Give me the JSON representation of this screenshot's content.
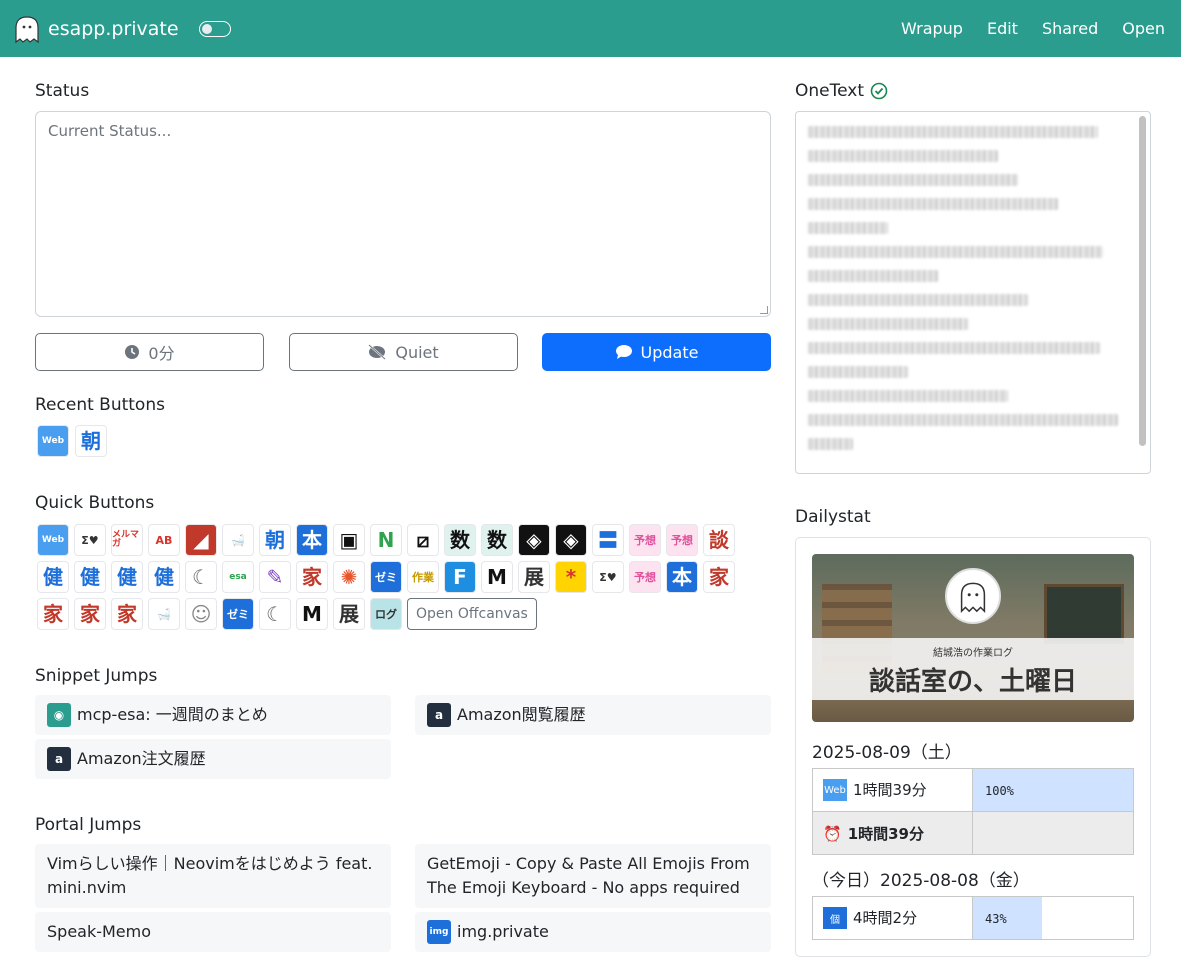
{
  "navbar": {
    "brand": "esapp.private",
    "links": [
      "Wrapup",
      "Edit",
      "Shared",
      "Open"
    ]
  },
  "status": {
    "title": "Status",
    "placeholder": "Current Status...",
    "timer_label": "0分",
    "quiet_label": "Quiet",
    "update_label": "Update"
  },
  "recent": {
    "title": "Recent Buttons",
    "items": [
      {
        "label": "Web",
        "bg": "#4a9ef0",
        "fg": "#ffffff"
      },
      {
        "label": "朝",
        "bg": "#ffffff",
        "fg": "#1e6fd9"
      }
    ]
  },
  "quick": {
    "title": "Quick Buttons",
    "items": [
      {
        "label": "Web",
        "bg": "#4a9ef0",
        "fg": "#ffffff"
      },
      {
        "label": "Σ♥",
        "bg": "#ffffff",
        "fg": "#333333"
      },
      {
        "label": "メルマガ",
        "bg": "#ffffff",
        "fg": "#d9342b"
      },
      {
        "label": "AB",
        "bg": "#ffffff",
        "fg": "#d9342b"
      },
      {
        "label": "◢",
        "bg": "#c0392b",
        "fg": "#ffffff"
      },
      {
        "label": "🛁",
        "bg": "#ffffff",
        "fg": "#888888"
      },
      {
        "label": "朝",
        "bg": "#ffffff",
        "fg": "#1e6fd9"
      },
      {
        "label": "本",
        "bg": "#1e6fd9",
        "fg": "#ffffff"
      },
      {
        "label": "▣",
        "bg": "#ffffff",
        "fg": "#111111"
      },
      {
        "label": "N",
        "bg": "#ffffff",
        "fg": "#2ea44f"
      },
      {
        "label": "⧄",
        "bg": "#ffffff",
        "fg": "#111111"
      },
      {
        "label": "数",
        "bg": "#e0f2ee",
        "fg": "#111111"
      },
      {
        "label": "数",
        "bg": "#e0f2ee",
        "fg": "#111111"
      },
      {
        "label": "◈",
        "bg": "#111111",
        "fg": "#ffffff"
      },
      {
        "label": "◈",
        "bg": "#111111",
        "fg": "#ffffff"
      },
      {
        "label": "〓",
        "bg": "#ffffff",
        "fg": "#1e6fd9"
      },
      {
        "label": "予想",
        "bg": "#fde2ef",
        "fg": "#e0529c"
      },
      {
        "label": "予想",
        "bg": "#fde2ef",
        "fg": "#e0529c"
      },
      {
        "label": "談",
        "bg": "#ffffff",
        "fg": "#c0392b"
      },
      {
        "label": "健",
        "bg": "#ffffff",
        "fg": "#1e6fd9"
      },
      {
        "label": "健",
        "bg": "#ffffff",
        "fg": "#1e6fd9"
      },
      {
        "label": "健",
        "bg": "#ffffff",
        "fg": "#1e6fd9"
      },
      {
        "label": "健",
        "bg": "#ffffff",
        "fg": "#1e6fd9"
      },
      {
        "label": "☾",
        "bg": "#ffffff",
        "fg": "#666666"
      },
      {
        "label": "esa",
        "bg": "#ffffff",
        "fg": "#2ea44f"
      },
      {
        "label": "✎",
        "bg": "#ffffff",
        "fg": "#7b3fc4"
      },
      {
        "label": "家",
        "bg": "#ffffff",
        "fg": "#c0392b"
      },
      {
        "label": "✺",
        "bg": "#ffffff",
        "fg": "#e8542c"
      },
      {
        "label": "ゼミ",
        "bg": "#1e6fd9",
        "fg": "#ffffff"
      },
      {
        "label": "作業",
        "bg": "#ffffff",
        "fg": "#c79a00"
      },
      {
        "label": "F",
        "bg": "#1e8fe0",
        "fg": "#ffffff"
      },
      {
        "label": "M",
        "bg": "#ffffff",
        "fg": "#111111"
      },
      {
        "label": "展",
        "bg": "#ffffff",
        "fg": "#333333"
      },
      {
        "label": "*",
        "bg": "#ffd400",
        "fg": "#d9342b"
      },
      {
        "label": "Σ♥",
        "bg": "#ffffff",
        "fg": "#333333"
      },
      {
        "label": "予想",
        "bg": "#fde2ef",
        "fg": "#e0529c"
      },
      {
        "label": "本",
        "bg": "#1e6fd9",
        "fg": "#ffffff"
      },
      {
        "label": "家",
        "bg": "#ffffff",
        "fg": "#c0392b"
      },
      {
        "label": "家",
        "bg": "#ffffff",
        "fg": "#c0392b"
      },
      {
        "label": "家",
        "bg": "#ffffff",
        "fg": "#c0392b"
      },
      {
        "label": "家",
        "bg": "#ffffff",
        "fg": "#c0392b"
      },
      {
        "label": "🛁",
        "bg": "#ffffff",
        "fg": "#888888"
      },
      {
        "label": "☺",
        "bg": "#ffffff",
        "fg": "#888888"
      },
      {
        "label": "ゼミ",
        "bg": "#1e6fd9",
        "fg": "#ffffff"
      },
      {
        "label": "☾",
        "bg": "#ffffff",
        "fg": "#666666"
      },
      {
        "label": "M",
        "bg": "#ffffff",
        "fg": "#111111"
      },
      {
        "label": "展",
        "bg": "#ffffff",
        "fg": "#333333"
      },
      {
        "label": "ログ",
        "bg": "#b8e4e8",
        "fg": "#333333"
      }
    ],
    "offcanvas_label": "Open Offcanvas"
  },
  "snippets": {
    "title": "Snippet Jumps",
    "items": [
      {
        "label": "mcp-esa: 一週間のまとめ",
        "icon_bg": "#2a9d8f",
        "icon_text": "e"
      },
      {
        "label": "Amazon閲覧履歴",
        "icon_bg": "#232f3e",
        "icon_text": "a"
      },
      {
        "label": "Amazon注文履歴",
        "icon_bg": "#232f3e",
        "icon_text": "a"
      }
    ]
  },
  "portal": {
    "title": "Portal Jumps",
    "items": [
      {
        "label": "Vimらしい操作｜Neovimをはじめよう feat. mini.nvim"
      },
      {
        "label": "GetEmoji - Copy & Paste All Emojis From The Emoji Keyboard - No apps required"
      },
      {
        "label": "Speak-Memo"
      },
      {
        "label": "img.private"
      }
    ]
  },
  "onetext": {
    "title": "OneText"
  },
  "dailystat": {
    "title": "Dailystat",
    "hero_sub": "結城浩の作業ログ",
    "hero_main": "談話室の、土曜日",
    "day1": {
      "date": "2025-08-09（土）",
      "rows": [
        {
          "label": "1時間39分",
          "percent_text": "100%",
          "percent": 100
        }
      ],
      "total": "1時間39分"
    },
    "day2": {
      "date": "（今日）2025-08-08（金）",
      "rows": [
        {
          "label": "4時間2分",
          "percent_text": "43%",
          "percent": 43
        }
      ]
    }
  }
}
